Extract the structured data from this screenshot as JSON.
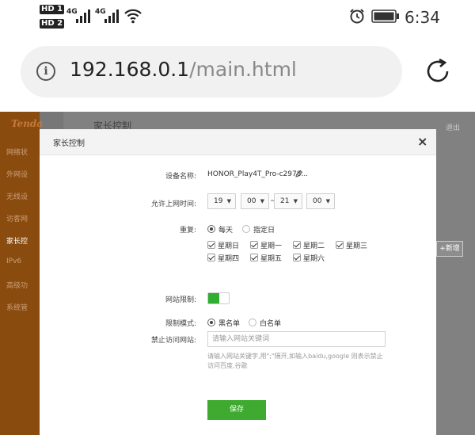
{
  "status_bar": {
    "sim1_badge": "HD 1",
    "sim2_badge": "HD 2",
    "network1": "4G",
    "network2": "4G",
    "time": "6:34"
  },
  "browser": {
    "url_host": "192.168.0.1",
    "url_path": "/main.html"
  },
  "sidebar": {
    "logo": "Tenda",
    "items": [
      {
        "label": "网络状"
      },
      {
        "label": "外网设"
      },
      {
        "label": "无线设"
      },
      {
        "label": "访客网"
      },
      {
        "label": "家长控"
      },
      {
        "label": "IPv6"
      },
      {
        "label": "高级功"
      },
      {
        "label": "系统管"
      }
    ]
  },
  "background_page": {
    "title": "家长控制",
    "exit": "退出",
    "add_button": "+新增"
  },
  "modal": {
    "title": "家长控制",
    "close": "×",
    "device_name_label": "设备名称:",
    "device_name_value": "HONOR_Play4T_Pro-c2978...",
    "allow_time_label": "允许上网时间:",
    "time_start_hour": "19",
    "time_start_min": "00",
    "time_sep": "~",
    "time_end_hour": "21",
    "time_end_min": "00",
    "repeat_label": "重复:",
    "repeat_options": [
      {
        "label": "每天",
        "selected": true
      },
      {
        "label": "指定日",
        "selected": false
      }
    ],
    "weekdays": [
      {
        "label": "星期日",
        "checked": true
      },
      {
        "label": "星期一",
        "checked": true
      },
      {
        "label": "星期二",
        "checked": true
      },
      {
        "label": "星期三",
        "checked": true
      },
      {
        "label": "星期四",
        "checked": true
      },
      {
        "label": "星期五",
        "checked": true
      },
      {
        "label": "星期六",
        "checked": true
      }
    ],
    "site_limit_label": "网站限制:",
    "site_limit_on": true,
    "limit_mode_label": "限制模式:",
    "limit_modes": [
      {
        "label": "黑名单",
        "selected": true
      },
      {
        "label": "白名单",
        "selected": false
      }
    ],
    "blocked_sites_label": "禁止访问网站:",
    "blocked_sites_placeholder": "请输入网站关键词",
    "hint": "请输入网站关键字,用\";\"隔开,如输入baidu,google 则表示禁止访问百度,谷歌",
    "save_button": "保存"
  },
  "colors": {
    "accent_green": "#3eaa2f",
    "sidebar_brown": "#8a4b0f"
  }
}
